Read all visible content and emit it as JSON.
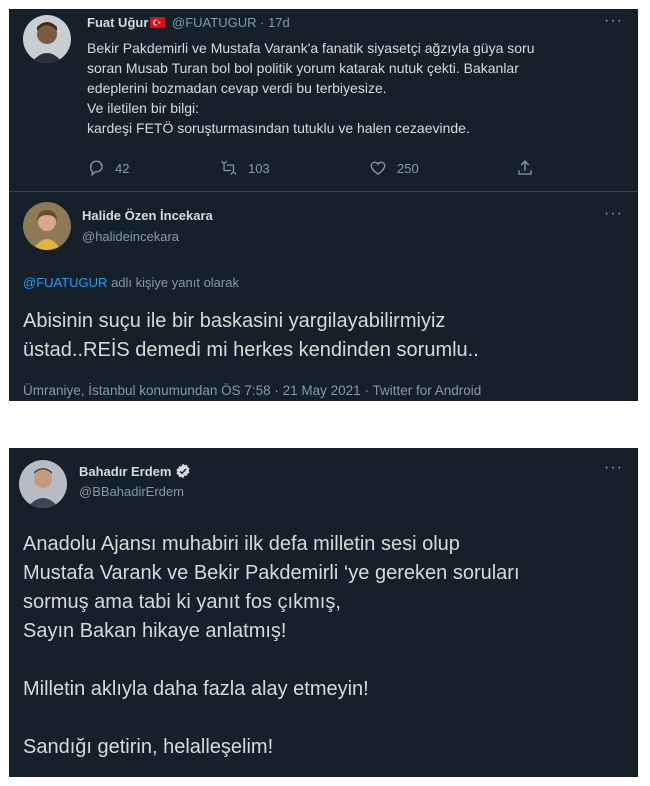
{
  "tweet1": {
    "author_name": "Fuat Uğur",
    "author_handle": "@FUATUGUR",
    "time_sep": "·",
    "time": "17d",
    "text_lines": [
      "Bekir Pakdemirli ve Mustafa Varank'a fanatik siyasetçi ağzıyla güya soru",
      "soran  Musab Turan bol bol politik yorum katarak nutuk çekti. Bakanlar",
      "edeplerini bozmadan cevap verdi bu terbiyesize.",
      "Ve iletilen bir bilgi:",
      "kardeşi FETÖ soruşturmasından tutuklu ve halen cezaevinde."
    ],
    "reply_count": "42",
    "retweet_count": "103",
    "like_count": "250"
  },
  "tweet2": {
    "author_name": "Halide Özen İncekara",
    "author_handle": "@halideincekara",
    "reply_to_handle": "@FUATUGUR",
    "reply_to_suffix": "adlı kişiye yanıt olarak",
    "text_lines": [
      "Abisinin suçu ile bir baskasini yargilayabilirmiyiz",
      "üstad..REİS demedi mi herkes kendinden sorumlu.."
    ],
    "meta": "Ümraniye, İstanbul konumundan ÖS 7:58 · 21 May 2021 · Twitter for Android"
  },
  "tweet3": {
    "author_name": "Bahadır Erdem",
    "author_handle": "@BBahadirErdem",
    "text_lines": [
      "Anadolu Ajansı muhabiri ilk defa milletin sesi olup",
      "Mustafa Varank ve Bekir Pakdemirli ‘ye gereken soruları",
      "sormuş ama tabi ki yanıt fos çıkmış,",
      "Sayın Bakan hikaye anlatmış!",
      "",
      "Milletin aklıyla daha fazla alay etmeyin!",
      "",
      "Sandığı getirin, helalleşelim!"
    ]
  },
  "icons": {
    "more": "more-icon",
    "reply": "reply-icon",
    "retweet": "retweet-icon",
    "like": "heart-icon",
    "share": "share-icon",
    "flag": "turkey-flag-icon",
    "verified": "verified-badge-icon"
  },
  "colors": {
    "background": "#15202b",
    "text": "#d9d9d9",
    "muted": "#8899a6",
    "link": "#1da1f2",
    "divider": "#38444d"
  },
  "more_glyph": "···"
}
